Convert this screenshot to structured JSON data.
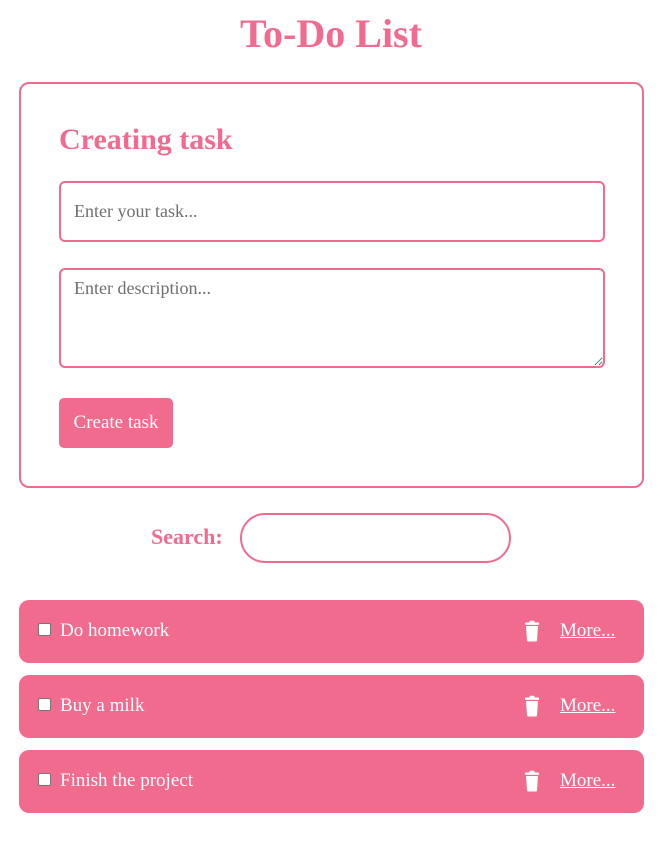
{
  "app": {
    "title": "To-Do List"
  },
  "create_form": {
    "heading": "Creating task",
    "task_placeholder": "Enter your task...",
    "task_value": "",
    "description_placeholder": "Enter description...",
    "description_value": "",
    "submit_label": "Create task"
  },
  "search": {
    "label": "Search:",
    "value": "",
    "placeholder": ""
  },
  "tasks": [
    {
      "label": "Do homework",
      "checked": false,
      "more_label": "More...",
      "delete_icon": "trash-icon"
    },
    {
      "label": "Buy a milk",
      "checked": false,
      "more_label": "More...",
      "delete_icon": "trash-icon"
    },
    {
      "label": "Finish the project",
      "checked": false,
      "more_label": "More...",
      "delete_icon": "trash-icon"
    }
  ],
  "colors": {
    "accent": "#f06b8e",
    "text_on_accent": "#ffffff",
    "background": "#ffffff"
  }
}
